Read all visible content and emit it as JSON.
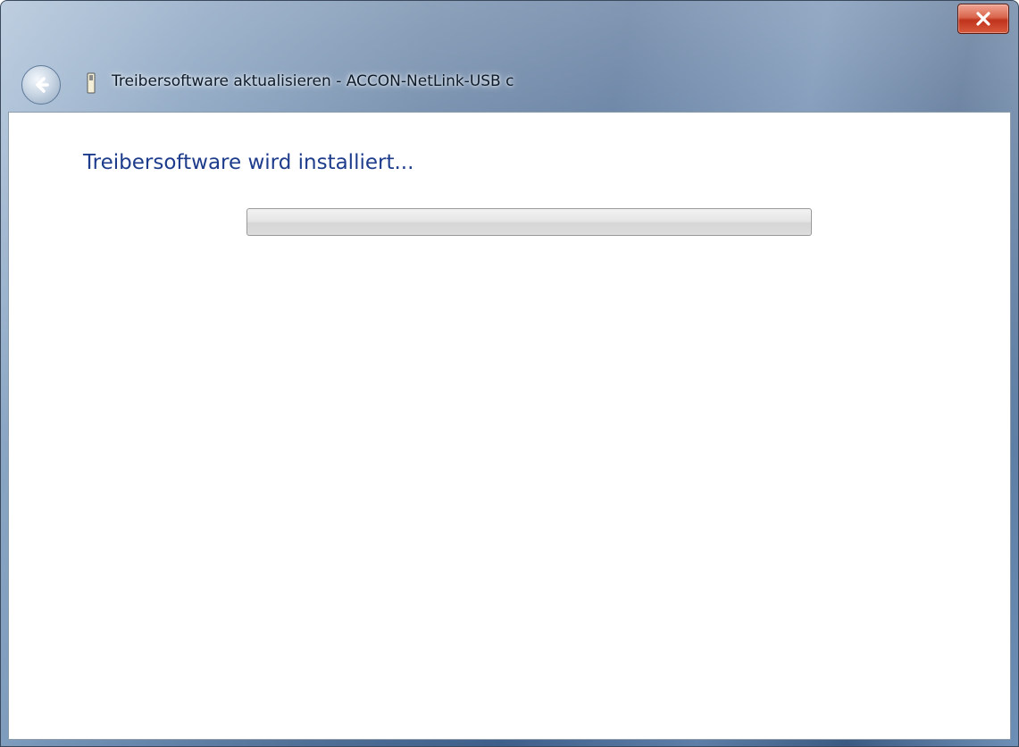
{
  "window": {
    "title": "Treibersoftware aktualisieren - ACCON-NetLink-USB c",
    "close_icon": "close-icon",
    "back_icon": "back-arrow-icon",
    "app_icon": "usb-device-icon"
  },
  "main": {
    "heading": "Treibersoftware wird installiert...",
    "progress": {
      "value": 0
    }
  },
  "colors": {
    "heading": "#1e3c8c",
    "close_button": "#c0331c",
    "title_bar": "#4f6f96"
  }
}
